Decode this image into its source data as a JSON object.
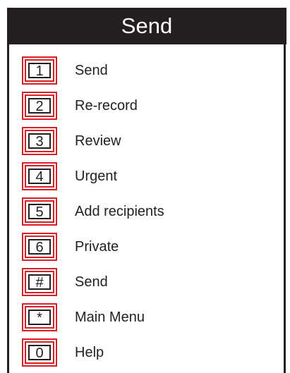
{
  "title": "Send",
  "colors": {
    "header_bg": "#231f20",
    "header_text": "#ffffff",
    "key_border": "#d62027",
    "text": "#231f20"
  },
  "menu": [
    {
      "key": "1",
      "label": "Send"
    },
    {
      "key": "2",
      "label": "Re-record"
    },
    {
      "key": "3",
      "label": "Review"
    },
    {
      "key": "4",
      "label": "Urgent"
    },
    {
      "key": "5",
      "label": "Add recipients"
    },
    {
      "key": "6",
      "label": "Private"
    },
    {
      "key": "#",
      "label": "Send"
    },
    {
      "key": "*",
      "label": "Main Menu"
    },
    {
      "key": "0",
      "label": "Help"
    }
  ]
}
